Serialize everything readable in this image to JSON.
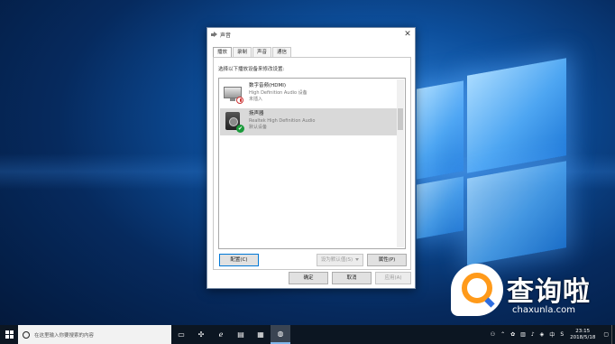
{
  "dialog": {
    "title": "声音",
    "close_glyph": "✕",
    "tabs": [
      {
        "label": "播放",
        "active": true
      },
      {
        "label": "录制",
        "active": false
      },
      {
        "label": "声音",
        "active": false
      },
      {
        "label": "通信",
        "active": false
      }
    ],
    "instruction": "选择以下播放设备来修改设置:",
    "devices": [
      {
        "name": "数字音频(HDMI)",
        "description": "High Definition Audio 设备",
        "status": "未插入",
        "icon": "monitor-icon",
        "badge": "disconnected-badge-icon"
      },
      {
        "name": "扬声器",
        "description": "Realtek High Definition Audio",
        "status": "默认设备",
        "icon": "speaker-icon",
        "badge": "default-check-icon",
        "selected": true
      }
    ],
    "buttons": {
      "configure": "配置(C)",
      "set_default": "设为默认值(S)",
      "properties": "属性(P)",
      "ok": "确定",
      "cancel": "取消",
      "apply": "应用(A)"
    }
  },
  "taskbar": {
    "search_placeholder": "在这里输入你要搜索的内容",
    "clock_time": "23:15",
    "clock_date": "2018/5/18",
    "ime": "中",
    "ime_mode": "S"
  },
  "watermark": {
    "title": "查询啦",
    "url": "chaxunla.com"
  },
  "colors": {
    "desktop": "#0d4f9c",
    "taskbar": "#0c1622",
    "accent": "#0078d7",
    "watermark_orange": "#ff9a1a"
  }
}
